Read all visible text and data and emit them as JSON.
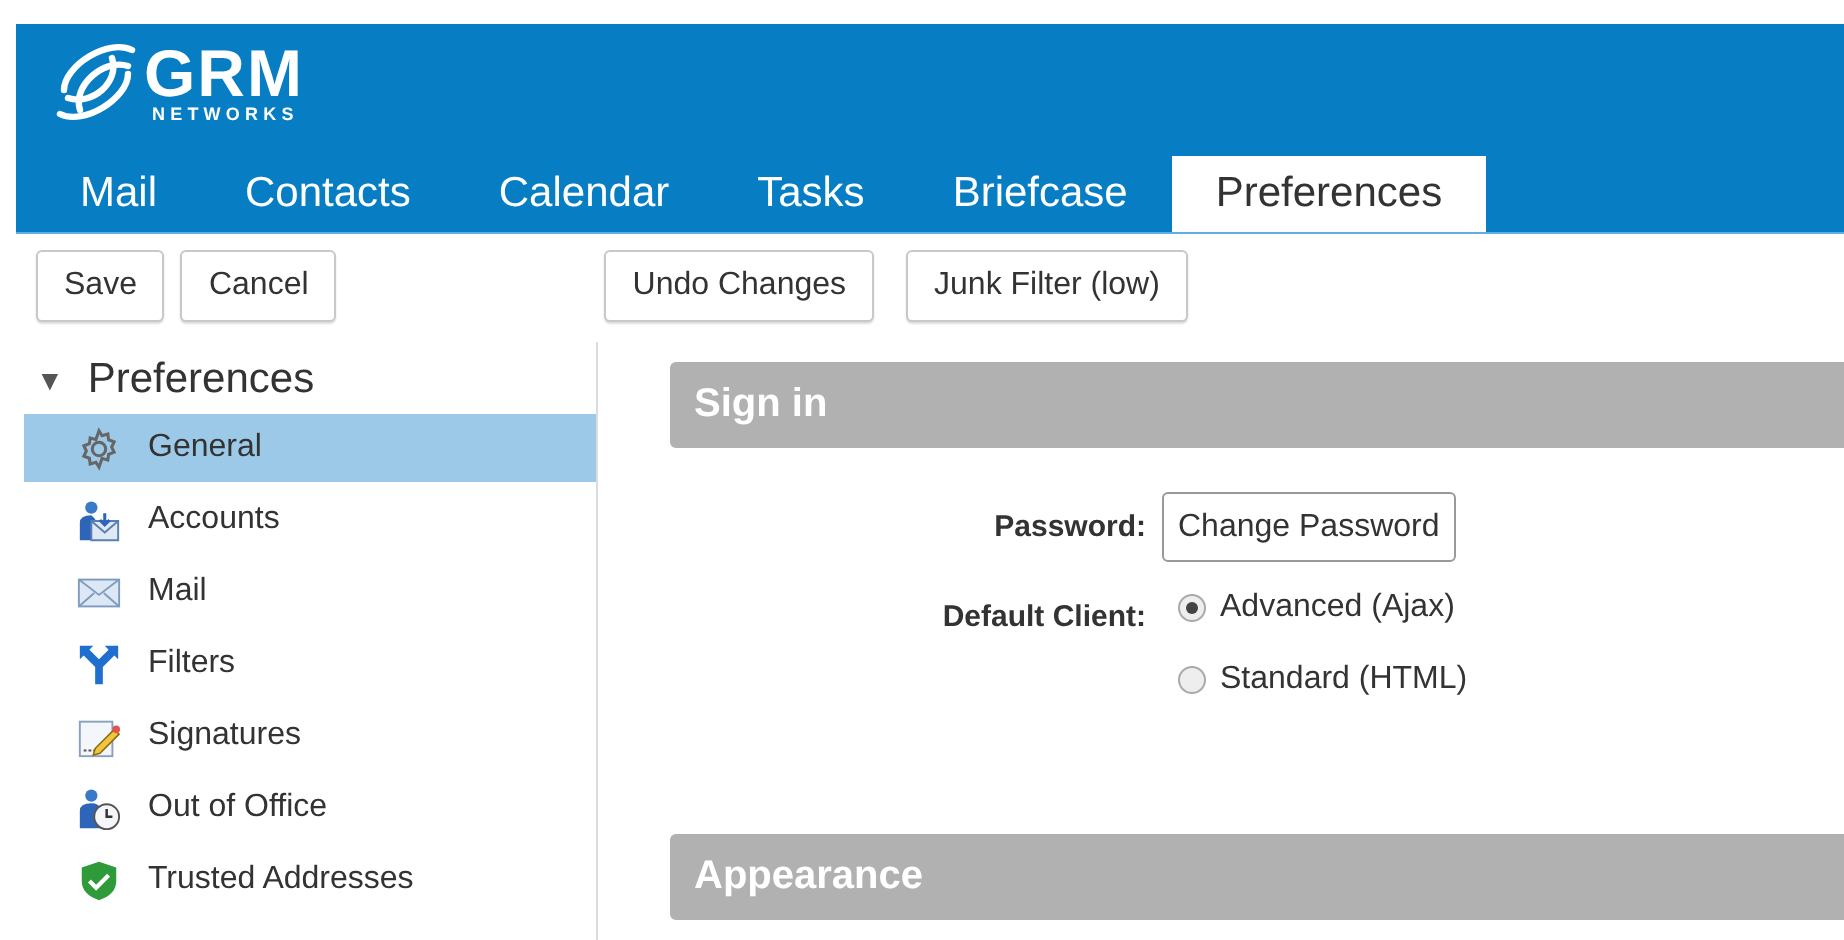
{
  "logo": {
    "name": "GRM",
    "subtitle": "NETWORKS"
  },
  "tabs": [
    {
      "label": "Mail",
      "selected": false
    },
    {
      "label": "Contacts",
      "selected": false
    },
    {
      "label": "Calendar",
      "selected": false
    },
    {
      "label": "Tasks",
      "selected": false
    },
    {
      "label": "Briefcase",
      "selected": false
    },
    {
      "label": "Preferences",
      "selected": true
    }
  ],
  "toolbar": {
    "left": [
      "Save",
      "Cancel"
    ],
    "right": [
      "Undo Changes",
      "Junk Filter (low)"
    ]
  },
  "sidebar": {
    "toggle": "▼",
    "title": "Preferences",
    "expanded": true,
    "items": [
      {
        "label": "General",
        "kind": "gear",
        "selected": true
      },
      {
        "label": "Accounts",
        "kind": "accounts",
        "selected": false
      },
      {
        "label": "Mail",
        "kind": "mail",
        "selected": false
      },
      {
        "label": "Filters",
        "kind": "filters",
        "selected": false
      },
      {
        "label": "Signatures",
        "kind": "signature",
        "selected": false
      },
      {
        "label": "Out of Office",
        "kind": "away",
        "selected": false
      },
      {
        "label": "Trusted Addresses",
        "kind": "trusted",
        "selected": false
      }
    ]
  },
  "sections": [
    {
      "title": "Sign in",
      "fields": [
        {
          "label": "Password:",
          "kind": "button",
          "text": "Change Password"
        },
        {
          "label": "Default Client:",
          "kind": "radio",
          "options": [
            {
              "label": "Advanced (Ajax)",
              "selected": true
            },
            {
              "label": "Standard (HTML)",
              "selected": false
            }
          ]
        }
      ]
    },
    {
      "title": "Appearance"
    }
  ]
}
